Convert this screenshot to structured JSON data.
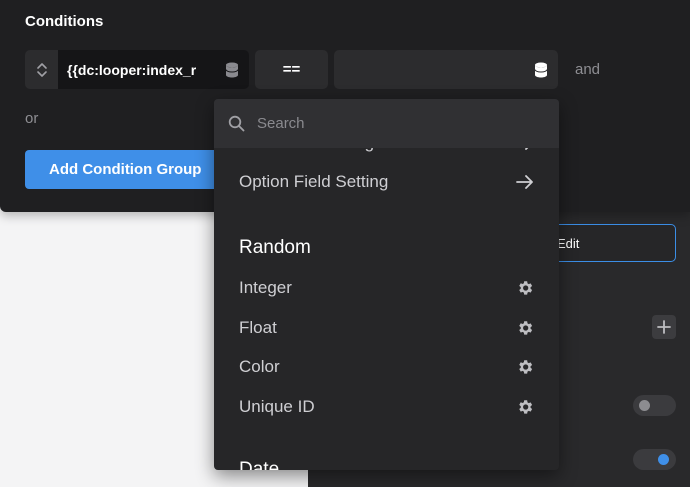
{
  "conditions": {
    "title": "Conditions",
    "dynamic_value": "{{dc:looper:index_r",
    "operator": "==",
    "value": "",
    "and_label": "and",
    "or_label": "or",
    "add_group_label": "Add Condition Group"
  },
  "dropdown": {
    "search_placeholder": "Search",
    "partial_top_item": "User Field Setting",
    "option_field_setting": "Option Field Setting",
    "group_random": "Random",
    "items": [
      {
        "label": "Integer",
        "icon": "gear-icon"
      },
      {
        "label": "Float",
        "icon": "gear-icon"
      },
      {
        "label": "Color",
        "icon": "gear-icon"
      },
      {
        "label": "Unique ID",
        "icon": "gear-icon"
      }
    ],
    "group_date_partial": "Date"
  },
  "side_panel": {
    "edit_label": "Edit",
    "toggle_1_on": false,
    "toggle_2_on": true
  },
  "colors": {
    "accent": "#3f8fe8",
    "panel_bg": "#1f1f21",
    "dropdown_bg": "#262628"
  }
}
